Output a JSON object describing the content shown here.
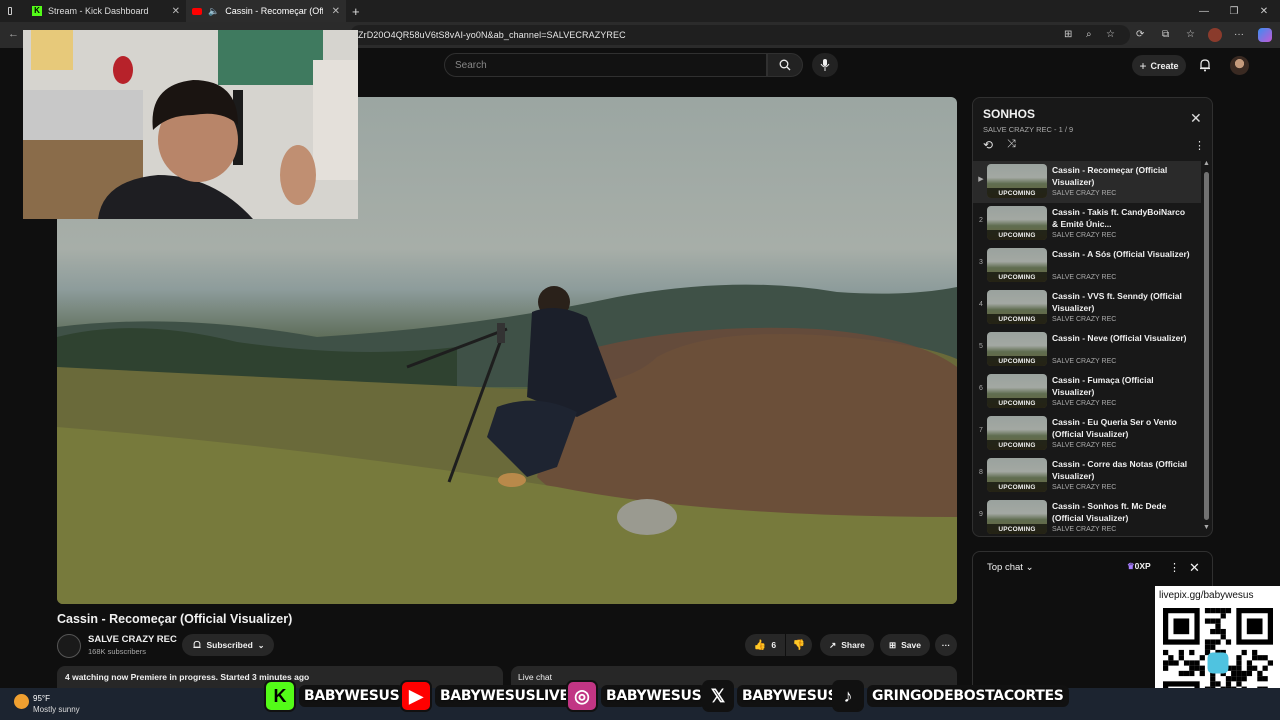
{
  "tabs": [
    {
      "label": "Stream - Kick Dashboard"
    },
    {
      "label": "Cassin - Recomeçar (Official"
    }
  ],
  "address_bar": {
    "url": "ZrD20O4QR58uV6tS8vAI-yo0N&ab_channel=SALVECRAZYREC"
  },
  "youtube": {
    "search_placeholder": "Search",
    "create_label": "Create"
  },
  "video": {
    "title": "Cassin - Recomeçar (Official Visualizer)",
    "channel": "SALVE CRAZY REC",
    "subscribers": "168K subscribers",
    "subscribed_label": "Subscribed",
    "likes": "6",
    "share_label": "Share",
    "save_label": "Save",
    "status_text": "4 watching now  Premiere in progress. Started 3 minutes ago",
    "live_chat_label": "Live chat"
  },
  "playlist": {
    "title": "SONHOS",
    "subtitle": "SALVE CRAZY REC - 1 / 9",
    "items": [
      {
        "num": "▶",
        "name": "Cassin - Recomeçar (Official Visualizer)",
        "channel": "SALVE CRAZY REC",
        "badge": "UPCOMING"
      },
      {
        "num": "2",
        "name": "Cassin - Takis ft. CandyBoiNarco & Emitê Únic...",
        "channel": "SALVE CRAZY REC",
        "badge": "UPCOMING"
      },
      {
        "num": "3",
        "name": "Cassin - A Sós (Official Visualizer)",
        "channel": "SALVE CRAZY REC",
        "badge": "UPCOMING"
      },
      {
        "num": "4",
        "name": "Cassin - VVS ft. Senndy (Official Visualizer)",
        "channel": "SALVE CRAZY REC",
        "badge": "UPCOMING"
      },
      {
        "num": "5",
        "name": "Cassin - Neve (Official Visualizer)",
        "channel": "SALVE CRAZY REC",
        "badge": "UPCOMING"
      },
      {
        "num": "6",
        "name": "Cassin - Fumaça (Official Visualizer)",
        "channel": "SALVE CRAZY REC",
        "badge": "UPCOMING"
      },
      {
        "num": "7",
        "name": "Cassin - Eu Queria Ser o Vento (Official Visualizer)",
        "channel": "SALVE CRAZY REC",
        "badge": "UPCOMING"
      },
      {
        "num": "8",
        "name": "Cassin - Corre das Notas (Official Visualizer)",
        "channel": "SALVE CRAZY REC",
        "badge": "UPCOMING"
      },
      {
        "num": "9",
        "name": "Cassin - Sonhos ft. Mc Dede (Official Visualizer)",
        "channel": "SALVE CRAZY REC",
        "badge": "UPCOMING"
      }
    ]
  },
  "chat": {
    "top_chat_label": "Top chat",
    "xp_label": "0XP"
  },
  "overlay": {
    "livepix": "livepix.gg/babywesus",
    "socials": [
      {
        "icon": "kick-icon",
        "handle": "BABYWESUS",
        "color": "#53fc18"
      },
      {
        "icon": "youtube-icon",
        "handle": "BABYWESUSLIVE",
        "color": "#ff0000"
      },
      {
        "icon": "instagram-icon",
        "handle": "BABYWESUS",
        "color": "#c13584"
      },
      {
        "icon": "x-icon",
        "handle": "BABYWESUS",
        "color": "#ffffff"
      },
      {
        "icon": "tiktok-icon",
        "handle": "GRINGODEBOSTACORTES",
        "color": "#ffffff"
      }
    ]
  },
  "taskbar": {
    "temperature": "95°F",
    "weather": "Mostly sunny"
  }
}
